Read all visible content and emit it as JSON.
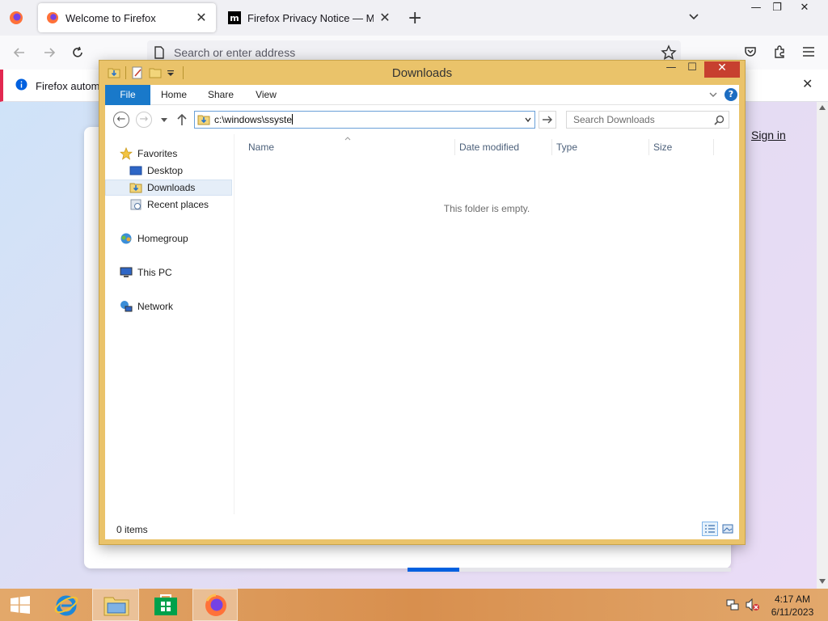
{
  "firefox": {
    "tabs": [
      {
        "title": "Welcome to Firefox",
        "active": true
      },
      {
        "title": "Firefox Privacy Notice — Mozill",
        "active": false
      }
    ],
    "urlbar_placeholder": "Search or enter address",
    "notification_text": "Firefox automa",
    "sign_in": "Sign in",
    "onboarding_progress": 0.16,
    "colors": {
      "accent": "#0060df",
      "notice_border": "#e22850"
    }
  },
  "explorer": {
    "title": "Downloads",
    "ribbon_tabs": [
      "File",
      "Home",
      "Share",
      "View"
    ],
    "help_label": "?",
    "address_value": "c:\\windows\\ssyste",
    "search_placeholder": "Search Downloads",
    "nav": {
      "favorites_label": "Favorites",
      "favorites_items": [
        {
          "label": "Desktop",
          "icon": "desktop-icon"
        },
        {
          "label": "Downloads",
          "icon": "downloads-folder-icon",
          "selected": true
        },
        {
          "label": "Recent places",
          "icon": "recent-places-icon"
        }
      ],
      "homegroup": "Homegroup",
      "this_pc": "This PC",
      "network": "Network"
    },
    "columns": [
      "Name",
      "Date modified",
      "Type",
      "Size"
    ],
    "empty_message": "This folder is empty.",
    "status": "0 items",
    "colors": {
      "frame": "#eac36a",
      "file_tab": "#1979ca",
      "close": "#c7402f"
    }
  },
  "taskbar": {
    "time": "4:17 AM",
    "date": "6/11/2023"
  }
}
